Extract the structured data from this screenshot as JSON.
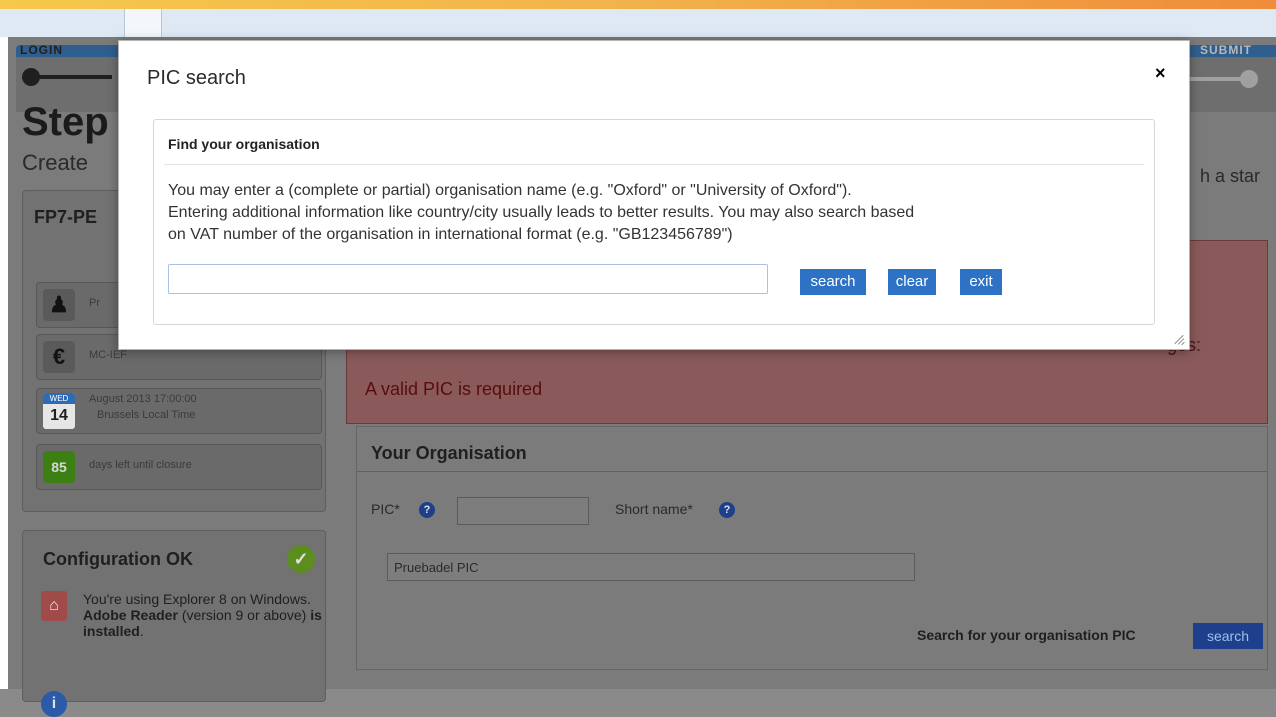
{
  "background": {
    "steps": {
      "first": "LOGIN",
      "last": "SUBMIT"
    },
    "step_title": "Step",
    "step_sub": "Create",
    "star_text": "h a star",
    "call": {
      "code": "FP7-PE"
    },
    "panel_rows": [
      {
        "icon": "person-icon",
        "text": "Pr"
      },
      {
        "icon": "euro-icon",
        "text": "MC-IEF"
      }
    ],
    "deadline": {
      "month": "WED",
      "day": "14",
      "line1": "August 2013 17:00:00",
      "line2": "Brussels Local Time"
    },
    "days_left": {
      "count": "85",
      "label": "days left until closure"
    },
    "config": {
      "title": "Configuration OK",
      "msg_line1": "You're using Explorer 8 on Windows.",
      "msg_bold1": "Adobe Reader",
      "msg_line2": "(version 9 or above)",
      "msg_bold2": "is installed",
      "msg_end": "."
    },
    "error": {
      "ages": "ges:",
      "message": "A valid PIC is required"
    },
    "org": {
      "title": "Your Organisation",
      "pic_label": "PIC*",
      "short_label": "Short name*",
      "name_value": "Pruebadel PIC",
      "search_label": "Search for your organisation PIC",
      "search_button": "search"
    }
  },
  "modal": {
    "title": "PIC search",
    "close": "×",
    "section_title": "Find your organisation",
    "desc_line1": "You may enter a (complete or partial) organisation name (e.g. \"Oxford\" or \"University of Oxford\").",
    "desc_line2": "Entering additional information like country/city usually leads to better results. You may also search based",
    "desc_line3": "on VAT number of the organisation in international format (e.g. \"GB123456789\")",
    "search_value": "",
    "buttons": {
      "search": "search",
      "clear": "clear",
      "exit": "exit"
    }
  },
  "colors": {
    "accent": "#2d72c4",
    "error": "#8a5a5a",
    "ok": "#5d8c1f"
  }
}
